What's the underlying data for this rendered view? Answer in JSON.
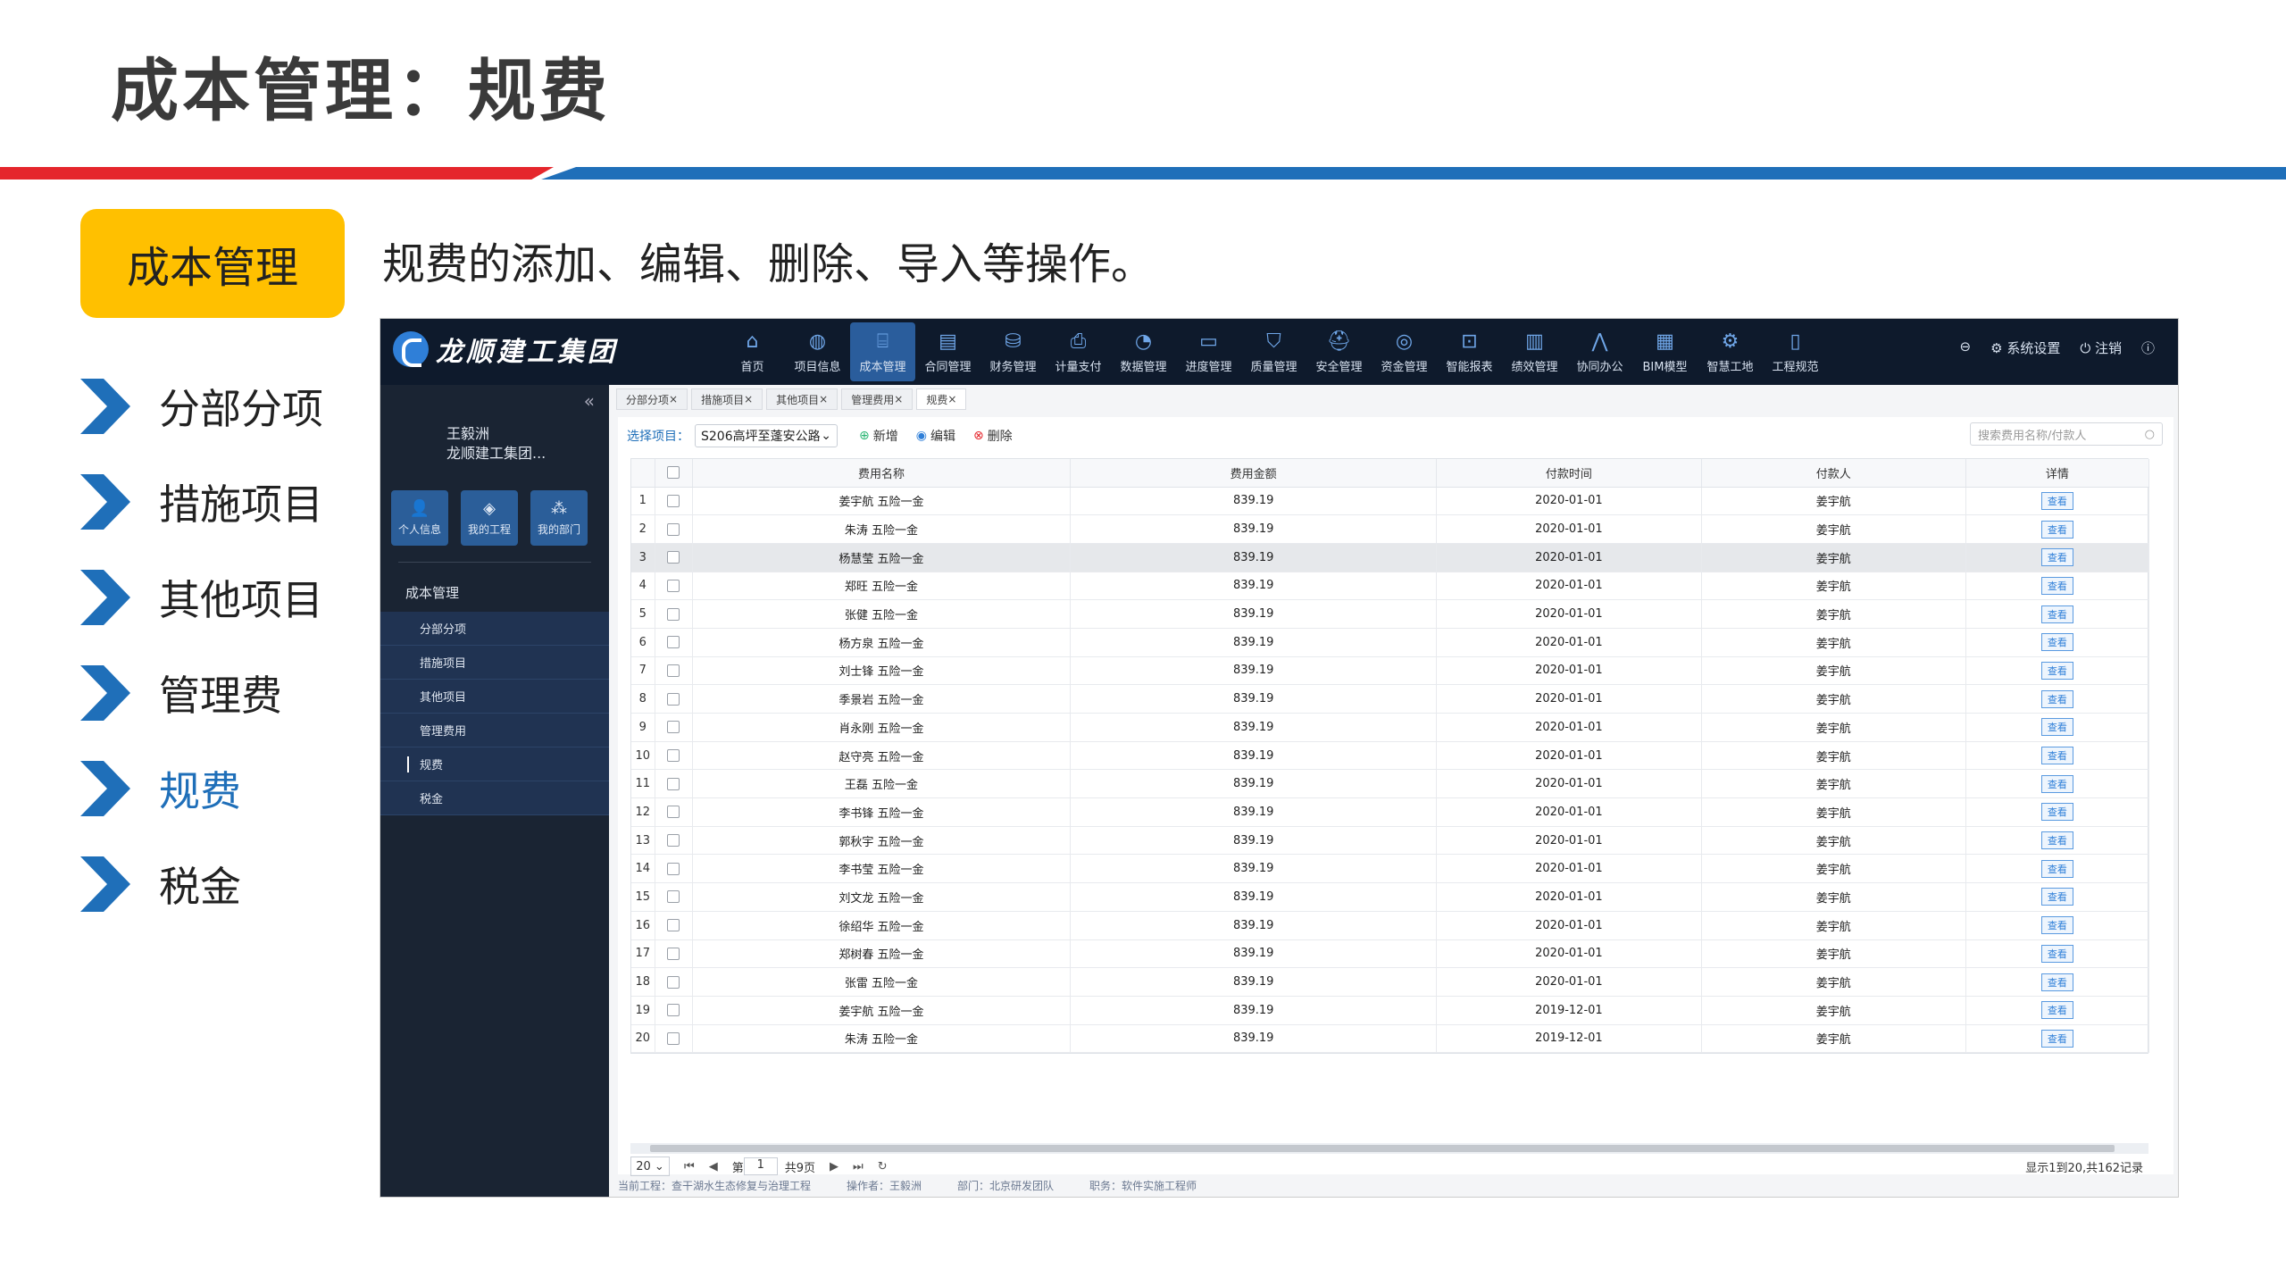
{
  "slide": {
    "title": "成本管理：规费",
    "badge": "成本管理",
    "subtitle": "规费的添加、编辑、删除、导入等操作。",
    "nav": [
      "分部分项",
      "措施项目",
      "其他项目",
      "管理费",
      "规费",
      "税金"
    ],
    "active_nav": "规费"
  },
  "app": {
    "logo_text": "龙顺建工集团",
    "modules": [
      {
        "label": "首页",
        "icon": "home-icon"
      },
      {
        "label": "项目信息",
        "icon": "project-icon"
      },
      {
        "label": "成本管理",
        "icon": "bank-icon"
      },
      {
        "label": "合同管理",
        "icon": "contract-icon"
      },
      {
        "label": "财务管理",
        "icon": "finance-icon"
      },
      {
        "label": "计量支付",
        "icon": "payment-icon"
      },
      {
        "label": "数据管理",
        "icon": "data-icon"
      },
      {
        "label": "进度管理",
        "icon": "progress-icon"
      },
      {
        "label": "质量管理",
        "icon": "quality-icon"
      },
      {
        "label": "安全管理",
        "icon": "safety-icon"
      },
      {
        "label": "资金管理",
        "icon": "funds-icon"
      },
      {
        "label": "智能报表",
        "icon": "report-icon"
      },
      {
        "label": "绩效管理",
        "icon": "performance-icon"
      },
      {
        "label": "协同办公",
        "icon": "office-icon"
      },
      {
        "label": "BIM模型",
        "icon": "bim-icon"
      },
      {
        "label": "智慧工地",
        "icon": "site-icon"
      },
      {
        "label": "工程规范",
        "icon": "spec-icon"
      }
    ],
    "active_module": "成本管理",
    "top_right": {
      "settings": "系统设置",
      "logout": "注销"
    },
    "sidebar": {
      "user_name": "王毅洲",
      "user_org": "龙顺建工集团...",
      "quick_buttons": [
        "个人信息",
        "我的工程",
        "我的部门"
      ],
      "group_title": "成本管理",
      "items": [
        "分部分项",
        "措施项目",
        "其他项目",
        "管理费用",
        "规费",
        "税金"
      ],
      "active_item": "规费"
    },
    "tabs": [
      "分部分项",
      "措施项目",
      "其他项目",
      "管理费用",
      "规费"
    ],
    "active_tab": "规费",
    "toolbar": {
      "select_label": "选择项目：",
      "select_value": "S206高坪至蓬安公路",
      "add": "新增",
      "edit": "编辑",
      "delete": "删除",
      "search_placeholder": "搜索费用名称/付款人"
    },
    "table": {
      "columns": [
        "费用名称",
        "费用金额",
        "付款时间",
        "付款人",
        "详情"
      ],
      "view_label": "查看",
      "rows": [
        {
          "no": "1",
          "name": "姜宇航 五险一金",
          "amount": "839.19",
          "date": "2020-01-01",
          "payer": "姜宇航"
        },
        {
          "no": "2",
          "name": "朱涛 五险一金",
          "amount": "839.19",
          "date": "2020-01-01",
          "payer": "姜宇航"
        },
        {
          "no": "3",
          "name": "杨慧莹 五险一金",
          "amount": "839.19",
          "date": "2020-01-01",
          "payer": "姜宇航"
        },
        {
          "no": "4",
          "name": "郑旺 五险一金",
          "amount": "839.19",
          "date": "2020-01-01",
          "payer": "姜宇航"
        },
        {
          "no": "5",
          "name": "张健 五险一金",
          "amount": "839.19",
          "date": "2020-01-01",
          "payer": "姜宇航"
        },
        {
          "no": "6",
          "name": "杨方泉 五险一金",
          "amount": "839.19",
          "date": "2020-01-01",
          "payer": "姜宇航"
        },
        {
          "no": "7",
          "name": "刘士锋 五险一金",
          "amount": "839.19",
          "date": "2020-01-01",
          "payer": "姜宇航"
        },
        {
          "no": "8",
          "name": "季景岩 五险一金",
          "amount": "839.19",
          "date": "2020-01-01",
          "payer": "姜宇航"
        },
        {
          "no": "9",
          "name": "肖永刚 五险一金",
          "amount": "839.19",
          "date": "2020-01-01",
          "payer": "姜宇航"
        },
        {
          "no": "10",
          "name": "赵守亮 五险一金",
          "amount": "839.19",
          "date": "2020-01-01",
          "payer": "姜宇航"
        },
        {
          "no": "11",
          "name": "王磊 五险一金",
          "amount": "839.19",
          "date": "2020-01-01",
          "payer": "姜宇航"
        },
        {
          "no": "12",
          "name": "李书锋 五险一金",
          "amount": "839.19",
          "date": "2020-01-01",
          "payer": "姜宇航"
        },
        {
          "no": "13",
          "name": "郭秋宇 五险一金",
          "amount": "839.19",
          "date": "2020-01-01",
          "payer": "姜宇航"
        },
        {
          "no": "14",
          "name": "李书莹 五险一金",
          "amount": "839.19",
          "date": "2020-01-01",
          "payer": "姜宇航"
        },
        {
          "no": "15",
          "name": "刘文龙 五险一金",
          "amount": "839.19",
          "date": "2020-01-01",
          "payer": "姜宇航"
        },
        {
          "no": "16",
          "name": "徐绍华 五险一金",
          "amount": "839.19",
          "date": "2020-01-01",
          "payer": "姜宇航"
        },
        {
          "no": "17",
          "name": "郑树春 五险一金",
          "amount": "839.19",
          "date": "2020-01-01",
          "payer": "姜宇航"
        },
        {
          "no": "18",
          "name": "张雷 五险一金",
          "amount": "839.19",
          "date": "2020-01-01",
          "payer": "姜宇航"
        },
        {
          "no": "19",
          "name": "姜宇航 五险一金",
          "amount": "839.19",
          "date": "2019-12-01",
          "payer": "姜宇航"
        },
        {
          "no": "20",
          "name": "朱涛 五险一金",
          "amount": "839.19",
          "date": "2019-12-01",
          "payer": "姜宇航"
        }
      ]
    },
    "pager": {
      "page_size": "20",
      "page_prefix": "第",
      "page": "1",
      "total_pages": "共9页",
      "info": "显示1到20,共162记录"
    },
    "status_bar": {
      "project": "当前工程：查干湖水生态修复与治理工程",
      "operator": "操作者：王毅洲",
      "dept": "部门：北京研发团队",
      "role": "职务：软件实施工程师"
    }
  },
  "colors": {
    "accent_blue": "#1f6fb9",
    "accent_red": "#e5262c",
    "badge_yellow": "#ffc000",
    "app_dark": "#0e1a2c"
  }
}
